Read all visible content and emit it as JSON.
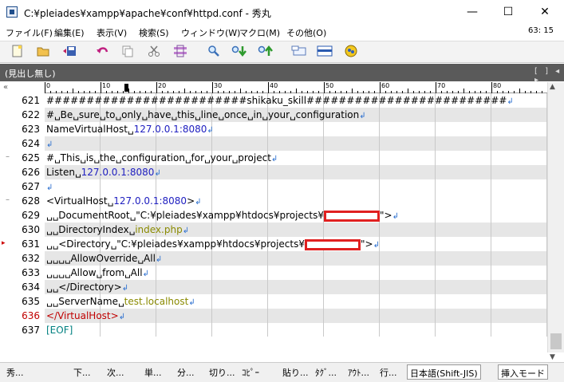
{
  "window": {
    "title": "C:¥pleiades¥xampp¥apache¥conf¥httpd.conf - 秀丸",
    "minimize": "—",
    "maximize": "☐",
    "close": "✕"
  },
  "menu": [
    "ファイル(F)",
    "編集(E)",
    "表示(V)",
    "検索(S)",
    "ウィンドウ(W)",
    "マクロ(M)",
    "その他(O)"
  ],
  "cursor_position": "63: 15",
  "toolbar": [
    "new-file-icon",
    "open-folder-icon",
    "save-icon",
    "undo-icon",
    "copy-icon",
    "cut-icon",
    "paste-icon",
    "find-icon",
    "find-down-icon",
    "find-up-icon",
    "grep-icon",
    "split-window-icon",
    "macro-icon"
  ],
  "outline": {
    "label": "(見出し無し)",
    "controls": "[ ] ◂ ▸"
  },
  "ruler": {
    "marks": [
      "0",
      "10",
      "20",
      "30",
      "40",
      "50",
      "60",
      "70",
      "80"
    ]
  },
  "lines": [
    {
      "num": "621",
      "segments": [
        [
          "",
          "#########################shikaku_skill#########################"
        ]
      ]
    },
    {
      "num": "622",
      "segments": [
        [
          "",
          "#␣Be␣sure␣to␣only␣have␣this␣line␣once␣in␣your␣configuration"
        ]
      ]
    },
    {
      "num": "623",
      "segments": [
        [
          "",
          "NameVirtualHost␣"
        ],
        [
          "blue",
          "127.0.0.1:8080"
        ]
      ]
    },
    {
      "num": "624",
      "segments": []
    },
    {
      "num": "625",
      "segments": [
        [
          "",
          "#␣This␣is␣the␣configuration␣for␣your␣project"
        ]
      ]
    },
    {
      "num": "626",
      "segments": [
        [
          "",
          "Listen␣"
        ],
        [
          "blue",
          "127.0.0.1:8080"
        ]
      ]
    },
    {
      "num": "627",
      "segments": []
    },
    {
      "num": "628",
      "segments": [
        [
          "",
          "<VirtualHost␣"
        ],
        [
          "blue",
          "127.0.0.1:8080"
        ],
        [
          "",
          ">"
        ]
      ]
    },
    {
      "num": "629",
      "segments": [
        [
          "",
          "␣␣DocumentRoot␣\"C:¥pleiades¥xampp¥htdocs¥projects¥"
        ],
        [
          "redact",
          ""
        ],
        [
          "",
          "\">"
        ]
      ]
    },
    {
      "num": "630",
      "segments": [
        [
          "",
          "␣␣DirectoryIndex␣"
        ],
        [
          "olive",
          "index.php"
        ]
      ]
    },
    {
      "num": "631",
      "segments": [
        [
          "",
          "␣␣<Directory␣\"C:¥pleiades¥xampp¥htdocs¥projects¥"
        ],
        [
          "redact",
          ""
        ],
        [
          "",
          "\">"
        ]
      ]
    },
    {
      "num": "632",
      "segments": [
        [
          "",
          "␣␣␣␣AllowOverride␣All"
        ]
      ]
    },
    {
      "num": "633",
      "segments": [
        [
          "",
          "␣␣␣␣Allow␣from␣All"
        ]
      ]
    },
    {
      "num": "634",
      "segments": [
        [
          "",
          "␣␣</Directory>"
        ]
      ]
    },
    {
      "num": "635",
      "segments": [
        [
          "",
          "␣␣ServerName␣"
        ],
        [
          "olive",
          "test.localhost"
        ]
      ]
    },
    {
      "num": "636",
      "segments": [
        [
          "red",
          "</VirtualHost>"
        ]
      ]
    },
    {
      "num": "637",
      "segments": [
        [
          "teal",
          "[EOF]"
        ]
      ]
    }
  ],
  "newline_glyph": "↲",
  "gutter": {
    "fold_glyph": "–",
    "collapse_glyph": "«",
    "marker_glyph": "▸"
  },
  "status": {
    "items": [
      "秀...",
      "下...",
      "次...",
      "単...",
      "分...",
      "切り...",
      "ｺﾋﾟｰ",
      "貼り...",
      "ﾀｸﾞ...",
      "ｱｳﾄ...",
      "行..."
    ],
    "encoding": "日本語(Shift-JIS)",
    "mode": "挿入モード"
  },
  "scroll": {
    "up": "▲",
    "down": "▼"
  }
}
